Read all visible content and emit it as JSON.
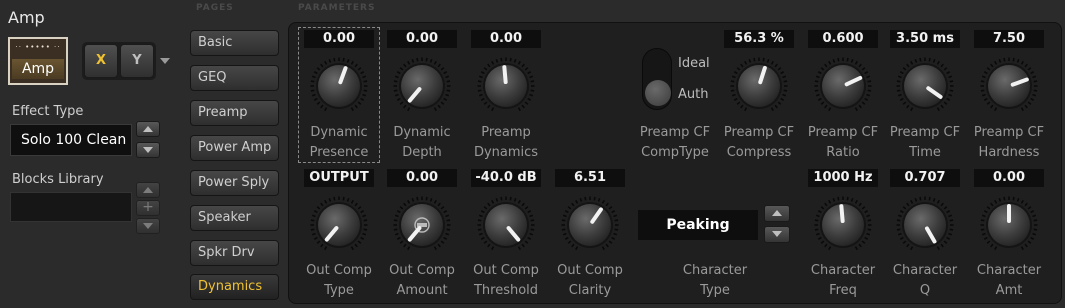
{
  "block": {
    "title": "Amp",
    "thumb_label": "Amp",
    "thumb_grill": "·· ••••• ··",
    "x_label": "X",
    "y_label": "Y"
  },
  "effect_type": {
    "label": "Effect Type",
    "value": "Solo 100 Clean"
  },
  "blocks_library": {
    "label": "Blocks Library"
  },
  "headers": {
    "pages": "PAGES",
    "parameters": "PARAMETERS"
  },
  "pages": [
    "Basic",
    "GEQ",
    "Preamp",
    "Power Amp",
    "Power Sply",
    "Speaker",
    "Spkr Drv",
    "Dynamics"
  ],
  "active_page": "Dynamics",
  "accent_color": "#f0c232",
  "row1": [
    {
      "value": "0.00",
      "label1": "Dynamic",
      "label2": "Presence",
      "angle": 20
    },
    {
      "value": "0.00",
      "label1": "Dynamic",
      "label2": "Depth",
      "angle": -140
    },
    {
      "value": "0.00",
      "label1": "Preamp",
      "label2": "Dynamics",
      "angle": -5
    },
    {
      "value": "56.3 %",
      "label1": "Preamp CF",
      "label2": "Compress",
      "angle": 18
    },
    {
      "value": "0.600",
      "label1": "Preamp CF",
      "label2": "Ratio",
      "angle": 65
    },
    {
      "value": "3.50 ms",
      "label1": "Preamp CF",
      "label2": "Time",
      "angle": 125
    },
    {
      "value": "7.50",
      "label1": "Preamp CF",
      "label2": "Hardness",
      "angle": 70
    }
  ],
  "row2": [
    {
      "value": "OUTPUT",
      "label1": "Out Comp",
      "label2": "Type",
      "angle": -140
    },
    {
      "value": "0.00",
      "label1": "Out Comp",
      "label2": "Amount",
      "angle": -140
    },
    {
      "value": "-40.0 dB",
      "label1": "Out Comp",
      "label2": "Threshold",
      "angle": 140
    },
    {
      "value": "6.51",
      "label1": "Out Comp",
      "label2": "Clarity",
      "angle": 35
    },
    {
      "value": "1000 Hz",
      "label1": "Character",
      "label2": "Freq",
      "angle": -5
    },
    {
      "value": "0.707",
      "label1": "Character",
      "label2": "Q",
      "angle": 150
    },
    {
      "value": "0.00",
      "label1": "Character",
      "label2": "Amt",
      "angle": 0
    }
  ],
  "comp_type": {
    "option_ideal": "Ideal",
    "option_auth": "Auth",
    "selected": "Auth",
    "label1": "Preamp CF",
    "label2": "CompType"
  },
  "character_type": {
    "value": "Peaking",
    "label1": "Character",
    "label2": "Type"
  }
}
